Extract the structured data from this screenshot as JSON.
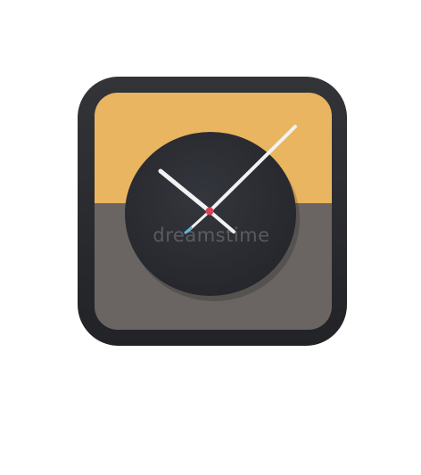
{
  "image": {
    "subject": "clock app icon",
    "icon": "clock-icon",
    "watermark_text": "dreamstime"
  },
  "colors": {
    "background": "#ffffff",
    "frame": "#2a2b2f",
    "top_panel": "#e9b560",
    "bottom_panel": "#6a6462",
    "dial": "#2b2d33",
    "hands": "#f2f2f2",
    "center_pin": "#d9425a",
    "hand_tip": "#5fb8d8"
  }
}
